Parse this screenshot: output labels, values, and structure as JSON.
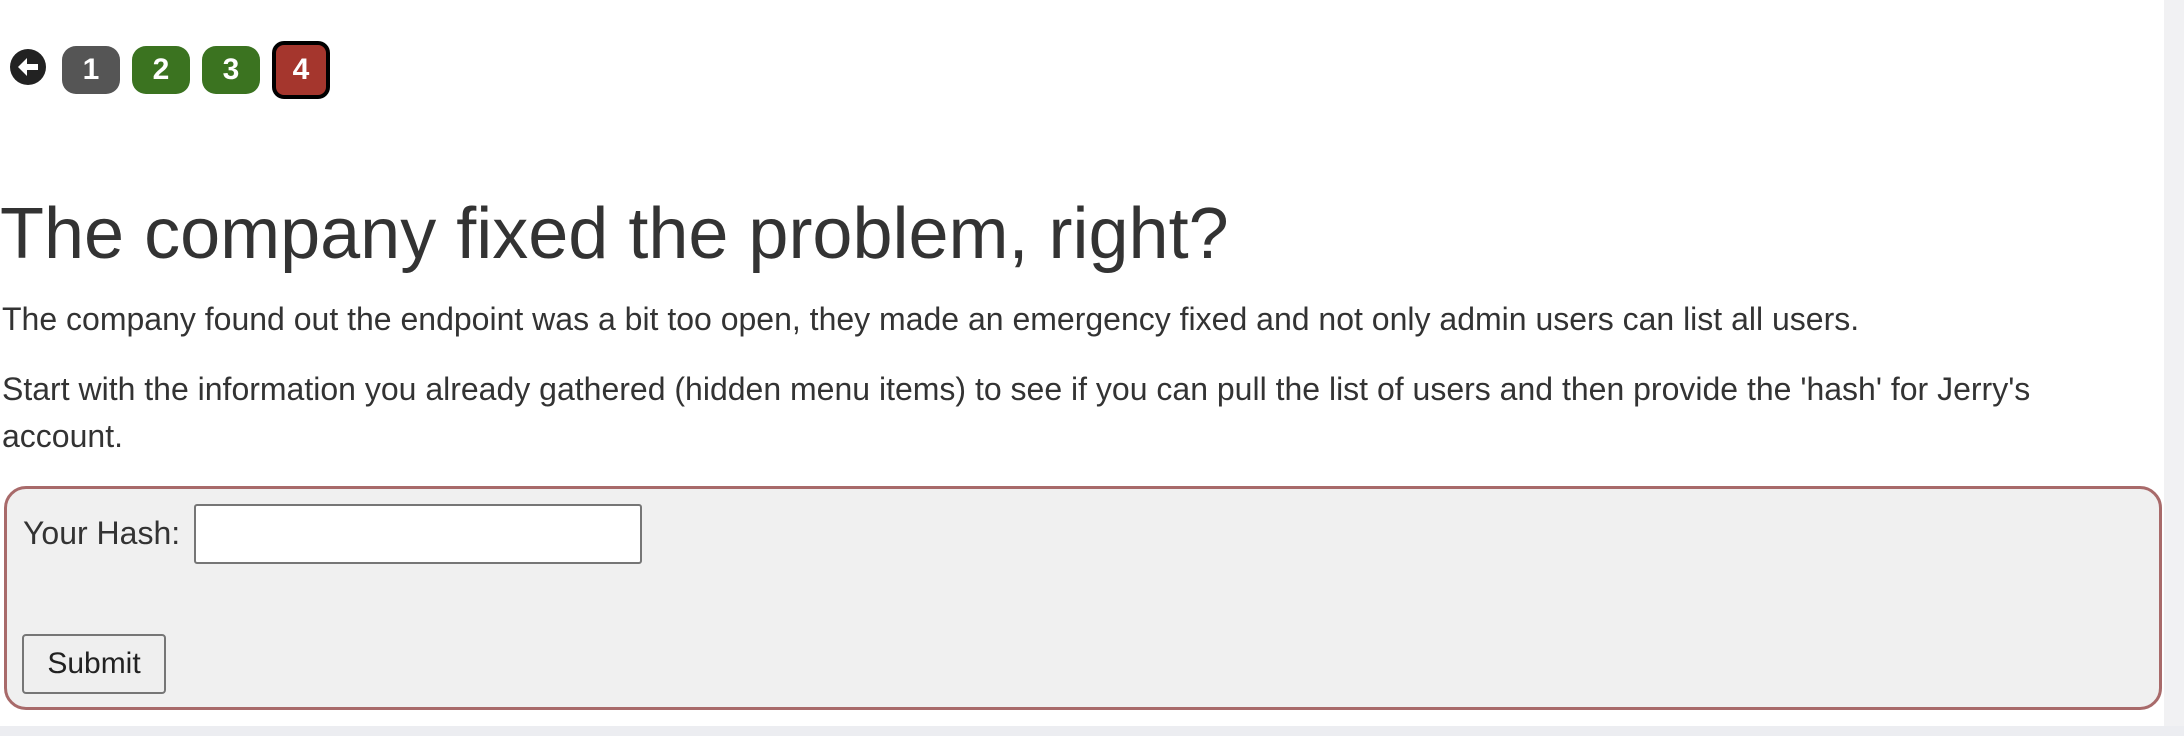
{
  "pager": {
    "back_icon": "arrow-left-circle-icon",
    "pages": [
      {
        "label": "1",
        "state": "done"
      },
      {
        "label": "2",
        "state": "solved"
      },
      {
        "label": "3",
        "state": "solved"
      },
      {
        "label": "4",
        "state": "current"
      }
    ],
    "colors": {
      "done": "#555555",
      "solved": "#3b7320",
      "current": "#a5362d"
    }
  },
  "lesson": {
    "title": "The company fixed the problem, right?",
    "paragraphs": [
      "The company found out the endpoint was a bit too open, they made an emergency fixed and not only admin users can list all users.",
      "Start with the information you already gathered (hidden menu items) to see if you can pull the list of users and then provide the 'hash' for Jerry's account."
    ]
  },
  "form": {
    "hash_label": "Your Hash:",
    "hash_value": "",
    "submit_label": "Submit",
    "border_color": "#a86a6a"
  }
}
